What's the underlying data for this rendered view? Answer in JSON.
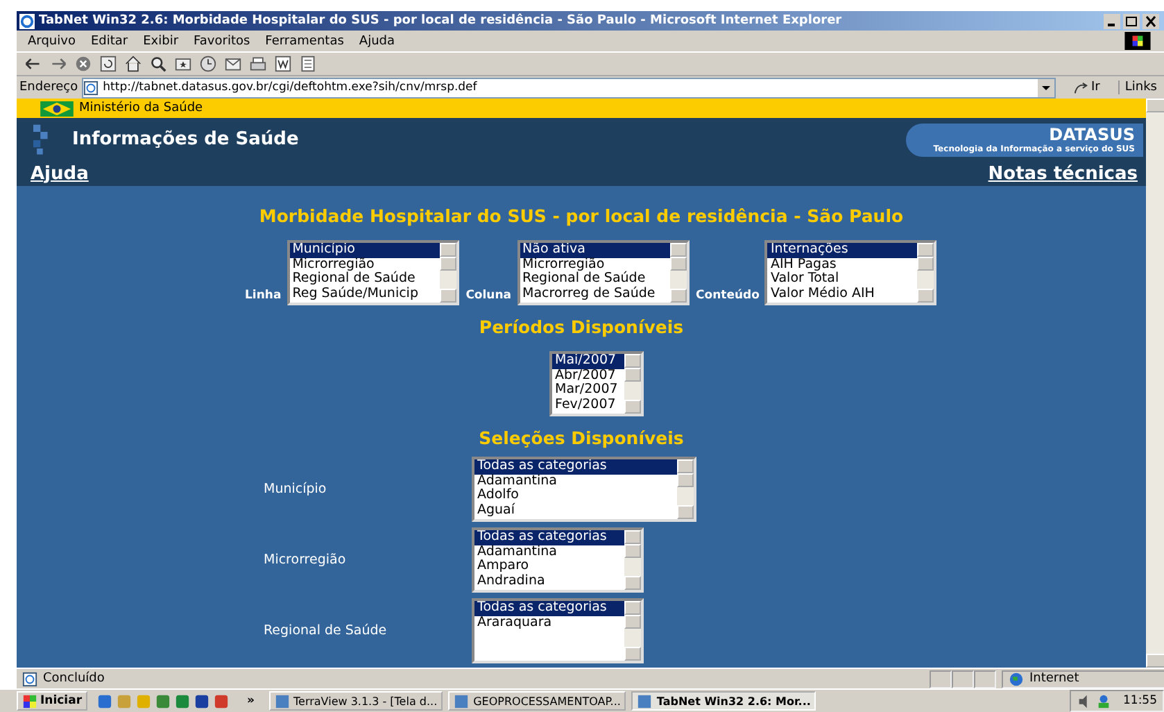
{
  "window": {
    "title": "TabNet Win32 2.6: Morbidade Hospitalar do SUS - por local de residência - São Paulo - Microsoft Internet Explorer"
  },
  "menu": [
    "Arquivo",
    "Editar",
    "Exibir",
    "Favoritos",
    "Ferramentas",
    "Ajuda"
  ],
  "address": {
    "label": "Endereço",
    "value": "http://tabnet.datasus.gov.br/cgi/deftohtm.exe?sih/cnv/mrsp.def",
    "go": "Ir",
    "links": "Links"
  },
  "site": {
    "ministry": "Ministério da Saúde",
    "title": "Informações de Saúde",
    "brand": "DATASUS",
    "tagline": "Tecnologia da Informação a serviço do SUS",
    "help": "Ajuda",
    "notes": "Notas técnicas"
  },
  "heading": "Morbidade Hospitalar do SUS - por local de residência - São Paulo",
  "selectors": [
    {
      "label": "Linha",
      "options": [
        {
          "text": "Município",
          "selected": true
        },
        {
          "text": "Microrregião",
          "selected": false
        },
        {
          "text": "Regional de Saúde",
          "selected": false
        },
        {
          "text": "Reg Saúde/Municip",
          "selected": false
        }
      ]
    },
    {
      "label": "Coluna",
      "options": [
        {
          "text": "Não ativa",
          "selected": true
        },
        {
          "text": "Microrregião",
          "selected": false
        },
        {
          "text": "Regional de Saúde",
          "selected": false
        },
        {
          "text": "Macrorreg de Saúde",
          "selected": false
        }
      ]
    },
    {
      "label": "Conteúdo",
      "options": [
        {
          "text": "Internações",
          "selected": true
        },
        {
          "text": "AIH Pagas",
          "selected": false
        },
        {
          "text": "Valor Total",
          "selected": false
        },
        {
          "text": "Valor Médio AIH",
          "selected": false
        }
      ]
    }
  ],
  "periods": {
    "title": "Períodos Disponíveis",
    "options": [
      {
        "text": "Mai/2007",
        "selected": true
      },
      {
        "text": "Abr/2007",
        "selected": false
      },
      {
        "text": "Mar/2007",
        "selected": false
      },
      {
        "text": "Fev/2007",
        "selected": false
      }
    ]
  },
  "selections": {
    "title": "Seleções Disponíveis",
    "filters": [
      {
        "label": "Município",
        "options": [
          {
            "text": "Todas as categorias",
            "selected": true
          },
          {
            "text": "Adamantina",
            "selected": false
          },
          {
            "text": "Adolfo",
            "selected": false
          },
          {
            "text": "Aguaí",
            "selected": false
          }
        ]
      },
      {
        "label": "Microrregião",
        "options": [
          {
            "text": "Todas as categorias",
            "selected": true
          },
          {
            "text": "Adamantina",
            "selected": false
          },
          {
            "text": "Amparo",
            "selected": false
          },
          {
            "text": "Andradina",
            "selected": false
          }
        ]
      },
      {
        "label": "Regional de Saúde",
        "options": [
          {
            "text": "Todas as categorias",
            "selected": true
          },
          {
            "text": "Araraquara",
            "selected": false
          }
        ]
      }
    ]
  },
  "status_bar": {
    "text": "Concluído",
    "zone": "Internet"
  },
  "taskbar": {
    "start": "Iniciar",
    "more": "»",
    "tasks": [
      {
        "label": "TerraView 3.1.3 - [Tela d...",
        "selected": false
      },
      {
        "label": "GEOPROCESSAMENTOAP...",
        "selected": false
      },
      {
        "label": "TabNet Win32 2.6: Mor...",
        "selected": true
      }
    ],
    "clock": "11:55"
  }
}
